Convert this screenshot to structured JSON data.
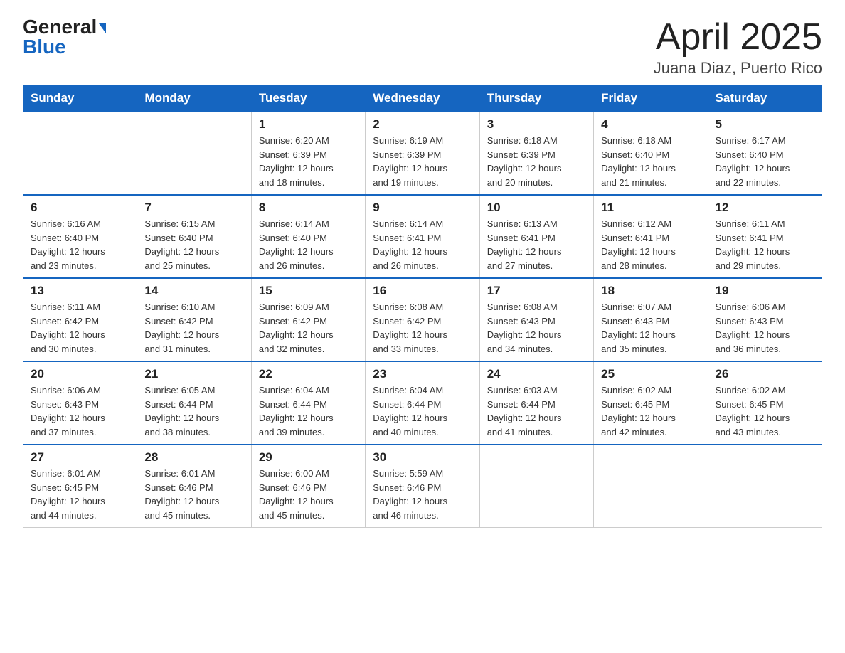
{
  "logo": {
    "general": "General",
    "blue": "Blue"
  },
  "title": "April 2025",
  "location": "Juana Diaz, Puerto Rico",
  "days_of_week": [
    "Sunday",
    "Monday",
    "Tuesday",
    "Wednesday",
    "Thursday",
    "Friday",
    "Saturday"
  ],
  "weeks": [
    [
      {
        "day": "",
        "detail": ""
      },
      {
        "day": "",
        "detail": ""
      },
      {
        "day": "1",
        "detail": "Sunrise: 6:20 AM\nSunset: 6:39 PM\nDaylight: 12 hours\nand 18 minutes."
      },
      {
        "day": "2",
        "detail": "Sunrise: 6:19 AM\nSunset: 6:39 PM\nDaylight: 12 hours\nand 19 minutes."
      },
      {
        "day": "3",
        "detail": "Sunrise: 6:18 AM\nSunset: 6:39 PM\nDaylight: 12 hours\nand 20 minutes."
      },
      {
        "day": "4",
        "detail": "Sunrise: 6:18 AM\nSunset: 6:40 PM\nDaylight: 12 hours\nand 21 minutes."
      },
      {
        "day": "5",
        "detail": "Sunrise: 6:17 AM\nSunset: 6:40 PM\nDaylight: 12 hours\nand 22 minutes."
      }
    ],
    [
      {
        "day": "6",
        "detail": "Sunrise: 6:16 AM\nSunset: 6:40 PM\nDaylight: 12 hours\nand 23 minutes."
      },
      {
        "day": "7",
        "detail": "Sunrise: 6:15 AM\nSunset: 6:40 PM\nDaylight: 12 hours\nand 25 minutes."
      },
      {
        "day": "8",
        "detail": "Sunrise: 6:14 AM\nSunset: 6:40 PM\nDaylight: 12 hours\nand 26 minutes."
      },
      {
        "day": "9",
        "detail": "Sunrise: 6:14 AM\nSunset: 6:41 PM\nDaylight: 12 hours\nand 26 minutes."
      },
      {
        "day": "10",
        "detail": "Sunrise: 6:13 AM\nSunset: 6:41 PM\nDaylight: 12 hours\nand 27 minutes."
      },
      {
        "day": "11",
        "detail": "Sunrise: 6:12 AM\nSunset: 6:41 PM\nDaylight: 12 hours\nand 28 minutes."
      },
      {
        "day": "12",
        "detail": "Sunrise: 6:11 AM\nSunset: 6:41 PM\nDaylight: 12 hours\nand 29 minutes."
      }
    ],
    [
      {
        "day": "13",
        "detail": "Sunrise: 6:11 AM\nSunset: 6:42 PM\nDaylight: 12 hours\nand 30 minutes."
      },
      {
        "day": "14",
        "detail": "Sunrise: 6:10 AM\nSunset: 6:42 PM\nDaylight: 12 hours\nand 31 minutes."
      },
      {
        "day": "15",
        "detail": "Sunrise: 6:09 AM\nSunset: 6:42 PM\nDaylight: 12 hours\nand 32 minutes."
      },
      {
        "day": "16",
        "detail": "Sunrise: 6:08 AM\nSunset: 6:42 PM\nDaylight: 12 hours\nand 33 minutes."
      },
      {
        "day": "17",
        "detail": "Sunrise: 6:08 AM\nSunset: 6:43 PM\nDaylight: 12 hours\nand 34 minutes."
      },
      {
        "day": "18",
        "detail": "Sunrise: 6:07 AM\nSunset: 6:43 PM\nDaylight: 12 hours\nand 35 minutes."
      },
      {
        "day": "19",
        "detail": "Sunrise: 6:06 AM\nSunset: 6:43 PM\nDaylight: 12 hours\nand 36 minutes."
      }
    ],
    [
      {
        "day": "20",
        "detail": "Sunrise: 6:06 AM\nSunset: 6:43 PM\nDaylight: 12 hours\nand 37 minutes."
      },
      {
        "day": "21",
        "detail": "Sunrise: 6:05 AM\nSunset: 6:44 PM\nDaylight: 12 hours\nand 38 minutes."
      },
      {
        "day": "22",
        "detail": "Sunrise: 6:04 AM\nSunset: 6:44 PM\nDaylight: 12 hours\nand 39 minutes."
      },
      {
        "day": "23",
        "detail": "Sunrise: 6:04 AM\nSunset: 6:44 PM\nDaylight: 12 hours\nand 40 minutes."
      },
      {
        "day": "24",
        "detail": "Sunrise: 6:03 AM\nSunset: 6:44 PM\nDaylight: 12 hours\nand 41 minutes."
      },
      {
        "day": "25",
        "detail": "Sunrise: 6:02 AM\nSunset: 6:45 PM\nDaylight: 12 hours\nand 42 minutes."
      },
      {
        "day": "26",
        "detail": "Sunrise: 6:02 AM\nSunset: 6:45 PM\nDaylight: 12 hours\nand 43 minutes."
      }
    ],
    [
      {
        "day": "27",
        "detail": "Sunrise: 6:01 AM\nSunset: 6:45 PM\nDaylight: 12 hours\nand 44 minutes."
      },
      {
        "day": "28",
        "detail": "Sunrise: 6:01 AM\nSunset: 6:46 PM\nDaylight: 12 hours\nand 45 minutes."
      },
      {
        "day": "29",
        "detail": "Sunrise: 6:00 AM\nSunset: 6:46 PM\nDaylight: 12 hours\nand 45 minutes."
      },
      {
        "day": "30",
        "detail": "Sunrise: 5:59 AM\nSunset: 6:46 PM\nDaylight: 12 hours\nand 46 minutes."
      },
      {
        "day": "",
        "detail": ""
      },
      {
        "day": "",
        "detail": ""
      },
      {
        "day": "",
        "detail": ""
      }
    ]
  ]
}
